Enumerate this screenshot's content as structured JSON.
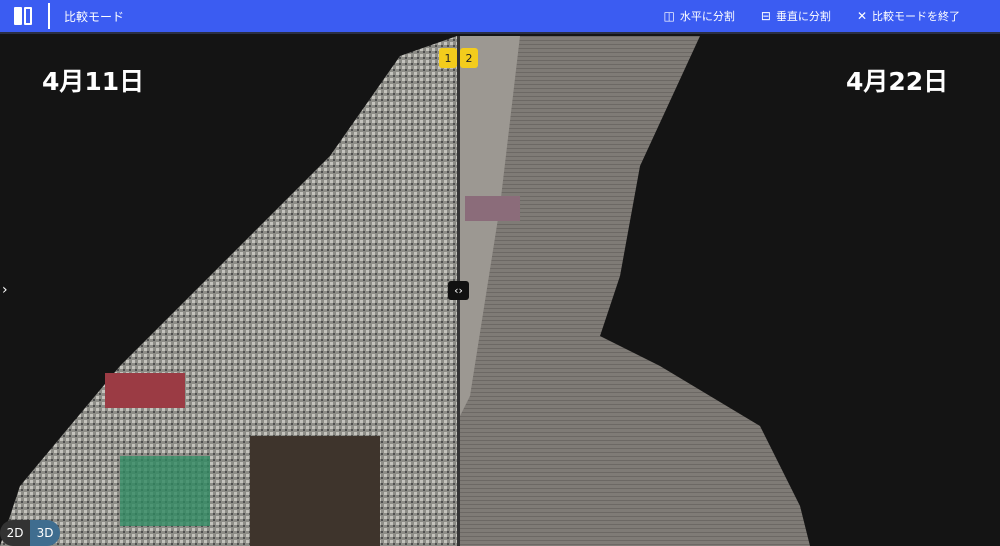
{
  "header": {
    "title": "比較モード",
    "actions": [
      {
        "icon": "split-horizontal-icon",
        "label": "水平に分割"
      },
      {
        "icon": "split-vertical-icon",
        "label": "垂直に分割"
      },
      {
        "icon": "close-icon",
        "label": "比較モードを終了"
      }
    ]
  },
  "left": {
    "date": "4月11日",
    "badge": "1"
  },
  "right": {
    "date": "4月22日",
    "badge": "2"
  },
  "handle": "‹›",
  "toggle": {
    "d2": "2D",
    "d3": "3D",
    "active": "3D"
  },
  "colors": {
    "header": "#3b5cf2",
    "badge": "#f3cc1c"
  }
}
